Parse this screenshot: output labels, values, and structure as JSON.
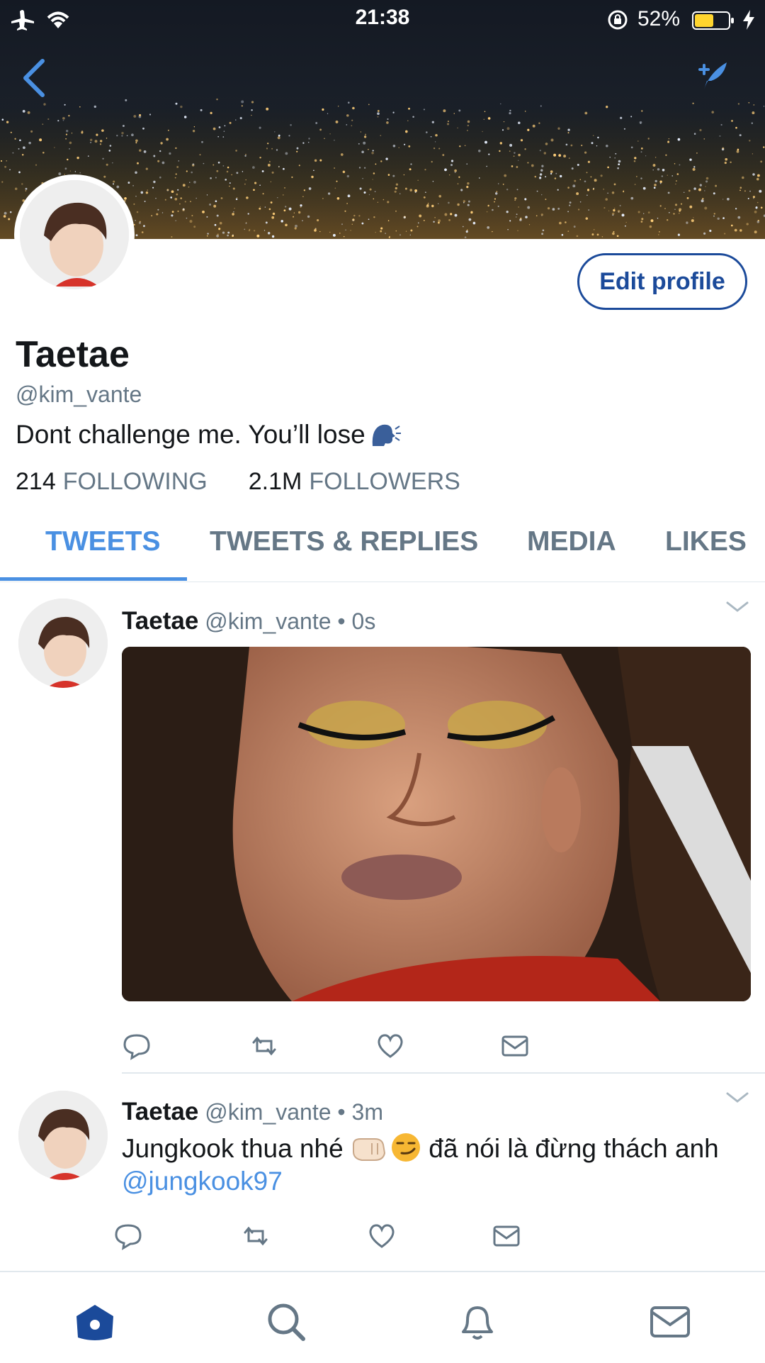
{
  "status_bar": {
    "time": "21:38",
    "battery_percent": "52%",
    "icons": [
      "airplane-icon",
      "wifi-icon",
      "orientation-lock-icon",
      "battery-icon",
      "charging-bolt-icon"
    ]
  },
  "header": {
    "back_icon": "chevron-left-icon",
    "compose_icon": "compose-tweet-icon"
  },
  "profile": {
    "name": "Taetae",
    "handle": "@kim_vante",
    "bio": "Dont challenge me. You’ll lose",
    "bio_emoji": "speaking-head-icon",
    "edit_button_label": "Edit profile",
    "following_count": "214",
    "following_label": "FOLLOWING",
    "followers_count": "2.1M",
    "followers_label": "FOLLOWERS"
  },
  "tabs": [
    {
      "label": "TWEETS",
      "active": true
    },
    {
      "label": "TWEETS & REPLIES",
      "active": false
    },
    {
      "label": "MEDIA",
      "active": false
    },
    {
      "label": "LIKES",
      "active": false
    }
  ],
  "tweets": [
    {
      "name": "Taetae",
      "meta": "@kim_vante • 0s",
      "has_media": true,
      "actions": [
        "reply-icon",
        "retweet-icon",
        "like-icon",
        "direct-message-icon"
      ]
    },
    {
      "name": "Taetae",
      "meta": "@kim_vante • 3m",
      "text_before": "Jungkook thua nhé ",
      "emojis": [
        "fist-icon",
        "smirking-face-icon"
      ],
      "text_after": " đã nói là đừng thách anh ",
      "mention": "@jungkook97",
      "actions": [
        "reply-icon",
        "retweet-icon",
        "like-icon",
        "direct-message-icon"
      ]
    }
  ],
  "bottom_nav": [
    "home-icon",
    "search-icon",
    "notifications-icon",
    "messages-icon"
  ],
  "colors": {
    "accent": "#4a90e2",
    "edit_border": "#1b4a9a",
    "secondary_text": "#657786",
    "nav_active": "#1b4a9a",
    "icon_gray": "#657786"
  }
}
